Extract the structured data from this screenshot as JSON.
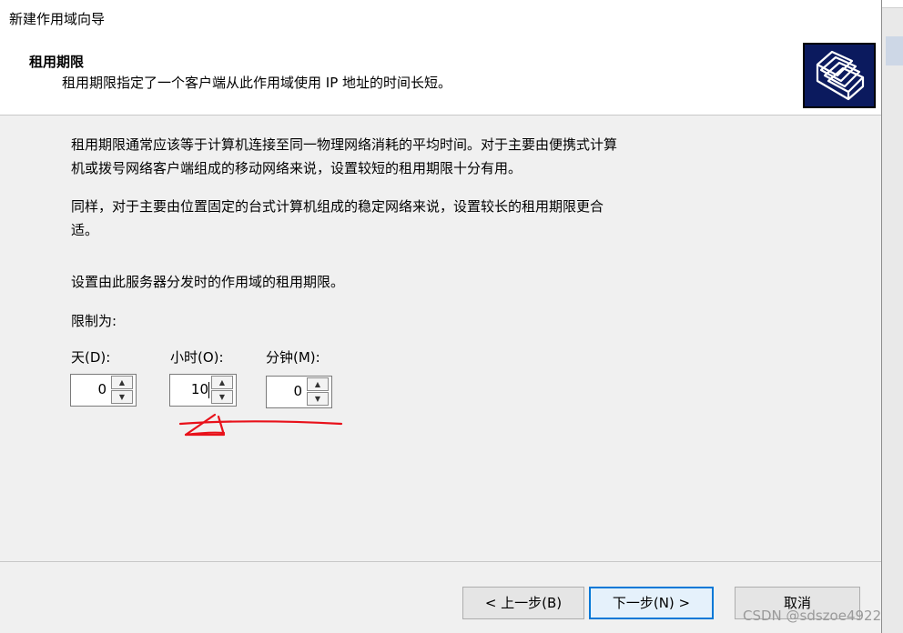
{
  "window": {
    "title": "新建作用域向导"
  },
  "header": {
    "title": "租用期限",
    "subtitle": "租用期限指定了一个客户端从此作用域使用 IP 地址的时间长短。",
    "icon": "wizard-folders-icon"
  },
  "body": {
    "paragraph1_line1": "租用期限通常应该等于计算机连接至同一物理网络消耗的平均时间。对于主要由便携式计算",
    "paragraph1_line2": "机或拨号网络客户端组成的移动网络来说，设置较短的租用期限十分有用。",
    "paragraph2_line1": "同样，对于主要由位置固定的台式计算机组成的稳定网络来说，设置较长的租用期限更合",
    "paragraph2_line2": "适。",
    "paragraph3": "设置由此服务器分发时的作用域的租用期限。",
    "limit_label": "限制为:"
  },
  "fields": {
    "days": {
      "label": "天(D):",
      "value": "0"
    },
    "hours": {
      "label": "小时(O):",
      "value": "10"
    },
    "minutes": {
      "label": "分钟(M):",
      "value": "0"
    }
  },
  "buttons": {
    "back": "< 上一步(B)",
    "next": "下一步(N) >",
    "cancel": "取消"
  },
  "watermark": "CSDN @sdszoe4922",
  "colors": {
    "accent": "#0078d7",
    "annotation": "#e8111a",
    "icon_bg": "#0b1a5e"
  }
}
